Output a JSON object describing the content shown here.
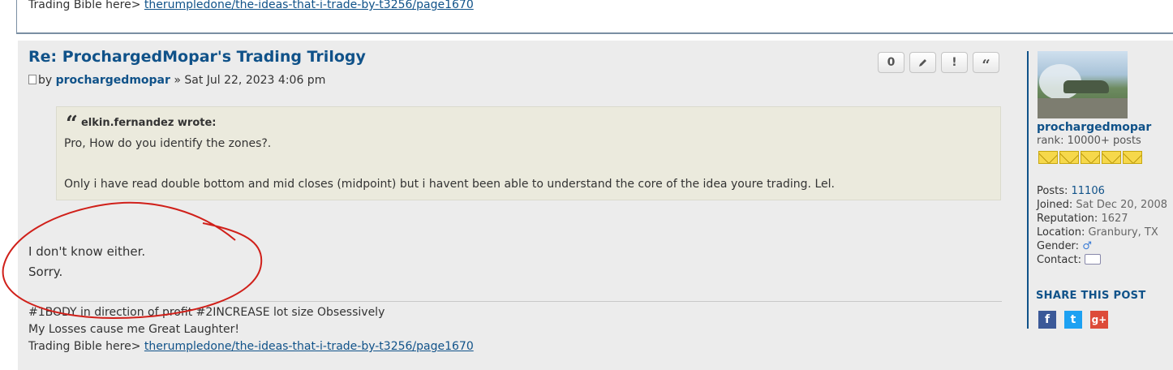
{
  "prev_post": {
    "sig_prefix": "Trading Bible here>",
    "sig_link": "therumpledone/the-ideas-that-i-trade-by-t3256/page1670"
  },
  "post": {
    "title": "Re: ProchargedMopar's Trading Trilogy",
    "by": "by",
    "author": "prochargedmopar",
    "date": "» Sat Jul 22, 2023 4:06 pm",
    "buttons": {
      "reputation_count": "0",
      "edit_icon": "pencil-icon",
      "report_label": "!",
      "quote_label": "“"
    },
    "quote": {
      "author_label": "elkin.fernandez wrote:",
      "line1": "Pro, How do you identify the zones?.",
      "line2": "Only i have read double bottom and mid closes (midpoint) but i havent been able to understand the core of the idea youre trading. Lel."
    },
    "body": {
      "line1": "I don't know either.",
      "line2": "Sorry."
    },
    "signature": {
      "line1": "#1BODY in direction of profit #2INCREASE lot size Obsessively",
      "line2": "My Losses cause me Great Laughter!",
      "link_prefix": "Trading Bible here>",
      "link_text": "therumpledone/the-ideas-that-i-trade-by-t3256/page1670"
    }
  },
  "profile": {
    "username": "prochargedmopar",
    "rank": "rank: 10000+ posts",
    "rank_icon_count": 5,
    "posts_label": "Posts:",
    "posts_value": "11106",
    "joined_label": "Joined:",
    "joined_value": "Sat Dec 20, 2008",
    "reputation_label": "Reputation:",
    "reputation_value": "1627",
    "location_label": "Location:",
    "location_value": "Granbury, TX",
    "gender_label": "Gender:",
    "gender_icon": "male-icon",
    "contact_label": "Contact:",
    "contact_icon": "speech-bubble-icon",
    "share_title": "SHARE THIS POST",
    "share": [
      "facebook-icon",
      "twitter-icon",
      "google-plus-icon"
    ]
  },
  "colors": {
    "link": "#105289",
    "post_bg": "#ececec",
    "quote_bg": "#ebeadd",
    "annotation": "#d0201a"
  }
}
